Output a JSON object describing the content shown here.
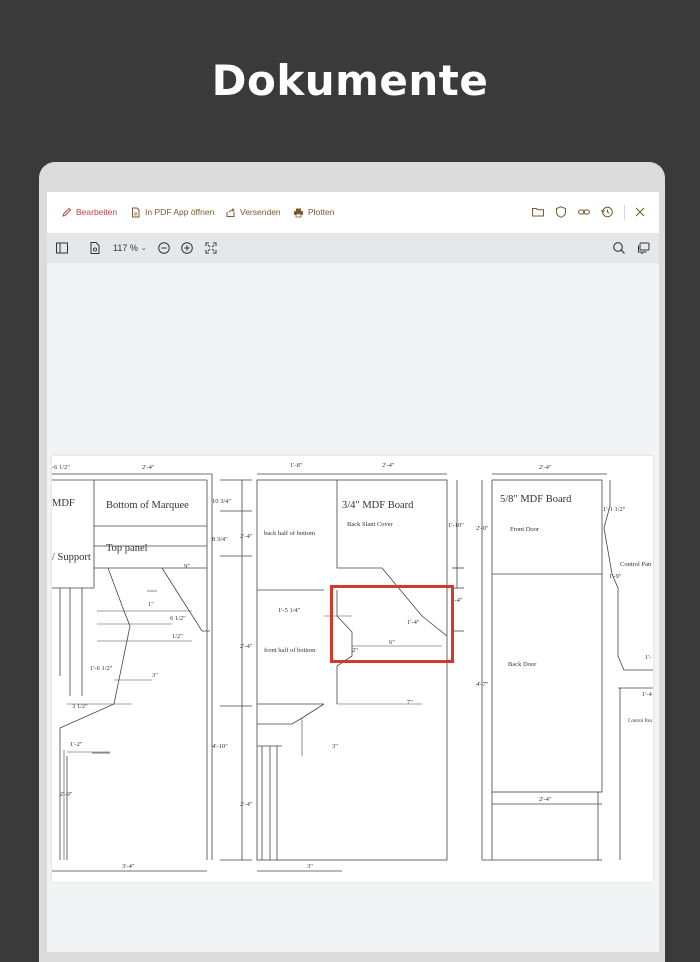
{
  "hero": {
    "title": "Dokumente"
  },
  "toolbar": {
    "edit": "Bearbeiten",
    "open_pdf_app": "In PDF App öffnen",
    "send": "Versenden",
    "plot": "Plotten"
  },
  "viewbar": {
    "zoom": "117 %"
  },
  "drawing": {
    "labels": {
      "d1": "-6 1/2\"",
      "d2": "2'-4\"",
      "d3": "1'-8\"",
      "d4": "2'-4\"",
      "d5": "2'-4\"",
      "mdf": "MDF",
      "bottom_marquee": "Bottom of Marquee",
      "top_panel": "Top panel",
      "support": "/ Support",
      "d_1034": "10 3/4\"",
      "d_834": "8 3/4\"",
      "d_24a": "2'-4\"",
      "d_9": "9\"",
      "d_1": "1\"",
      "d_612": "6 1/2\"",
      "d_12": "1/2\"",
      "d_1612": "1'-6 1/2\"",
      "d_3": "3\"",
      "d_312": "3 1/2\"",
      "d_12b": "1'-2\"",
      "d_29": "2'-9\"",
      "d_34": "3'-4\"",
      "d_24b": "2'-4\"",
      "d_410": "4'-10\"",
      "d_24c": "2'-4\"",
      "back_half": "back half of bottom",
      "front_half": "front half of bottom",
      "d_1514": "1'-5 1/4\"",
      "mdf34": "3/4\" MDF Board",
      "back_slant": "Back Slant Cover",
      "d_110": "1'-10\"",
      "d_14": "1'-4\"",
      "d_14b": "1'-4\"",
      "d_6": "6\"",
      "d_2": "2\"",
      "d_7": "7\"",
      "d_3b": "3\"",
      "d_3c": "3\"",
      "d_20": "2'-0\"",
      "mdf58": "5/8\" MDF Board",
      "front_door": "Front Door",
      "back_door": "Back Door",
      "d_47": "4'-7\"",
      "d_24d": "2'-4\"",
      "d_1112": "1'-1 1/2\"",
      "d_19": "1'-9\"",
      "control_pan": "Control Pan",
      "control_pan2": "Control Pan",
      "d_14c": "1'-4",
      "d_1x": "1'-"
    }
  }
}
